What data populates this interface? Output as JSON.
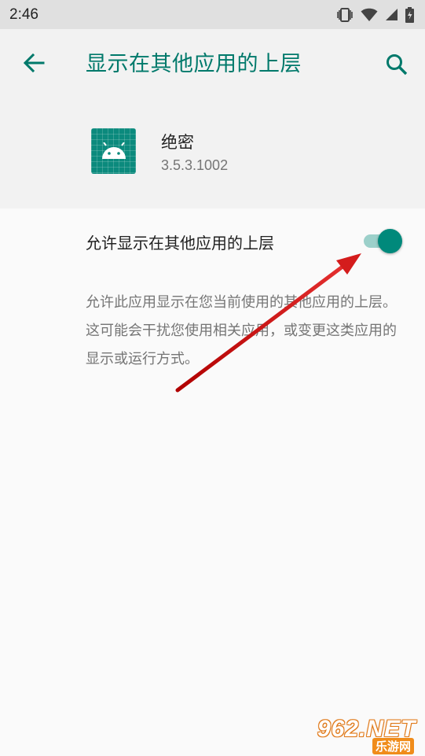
{
  "status_bar": {
    "time": "2:46",
    "icons": [
      "vibrate-icon",
      "wifi-icon",
      "signal-icon",
      "battery-charging-icon"
    ]
  },
  "app_bar": {
    "title": "显示在其他应用的上层",
    "back_icon": "arrow-back-icon",
    "search_icon": "search-icon",
    "accent_color": "#00796b"
  },
  "app_info": {
    "name": "绝密",
    "version": "3.5.3.1002",
    "icon": "android-icon",
    "icon_color": "#0b8a7d"
  },
  "setting": {
    "label": "允许显示在其他应用的上层",
    "enabled": true,
    "summary": "允许此应用显示在您当前使用的其他应用的上层。这可能会干扰您使用相关应用，或变更这类应用的显示或运行方式。"
  },
  "watermark": {
    "top": "962.NET",
    "bottom": "乐游网"
  }
}
